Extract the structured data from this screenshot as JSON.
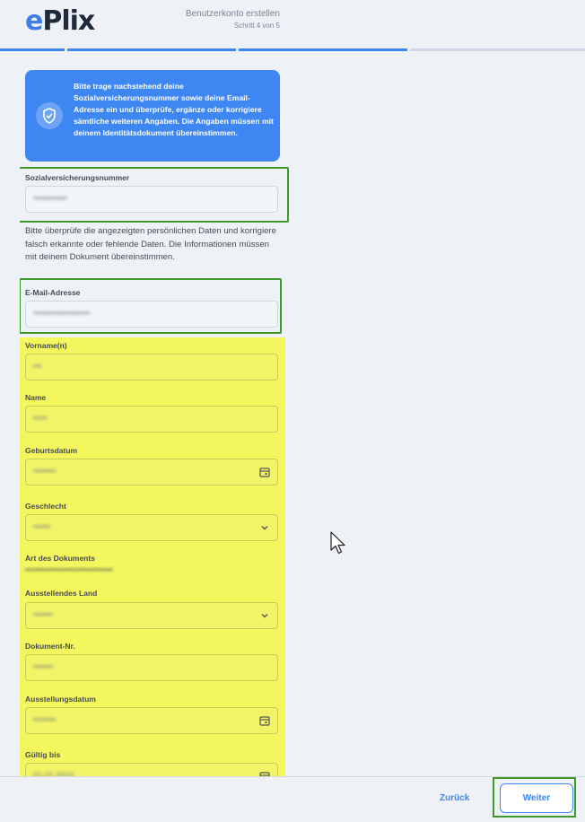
{
  "header": {
    "logo_e": "e",
    "logo_rest": "Plix",
    "title": "Benutzerkonto erstellen",
    "step": "Schritt 4 von 5"
  },
  "banner": {
    "icon": "shield-check-icon",
    "text": "Bitte trage nachstehend deine Sozialversicherungsnummer sowie deine Email-Adresse ein und überprüfe, ergänze oder korrigiere sämtliche weiteren Angaben. Die Angaben müssen mit deinem Identitätsdokument übereinstimmen."
  },
  "fields": {
    "svn": {
      "label": "Sozialversicherungsnummer",
      "value": "••••••••••••"
    },
    "info_text": "Bitte überprüfe die angezeigten persönlichen Daten und korrigiere falsch erkannte oder fehlende Daten. Die Informationen müssen mit deinem Dokument übereinstimmen.",
    "email": {
      "label": "E-Mail-Adresse",
      "value": "••••••••••••••••••••"
    },
    "vorname": {
      "label": "Vorname(n)",
      "value": "•••"
    },
    "name": {
      "label": "Name",
      "value": "•••••"
    },
    "geburtsdatum": {
      "label": "Geburtsdatum",
      "value": "••••••••"
    },
    "geschlecht": {
      "label": "Geschlecht",
      "value": "••••••"
    },
    "art_dokument": {
      "label": "Art des Dokuments",
      "value": "•••••••••••••••••••••••••••••••"
    },
    "land": {
      "label": "Ausstellendes Land",
      "value": "•••••••"
    },
    "dokument_nr": {
      "label": "Dokument-Nr.",
      "value": "•••••••"
    },
    "ausstellungsdatum": {
      "label": "Ausstellungsdatum",
      "value": "••••••••"
    },
    "gueltig_bis": {
      "label": "Gültig bis",
      "value": "01.01.2010"
    }
  },
  "footer": {
    "back_label": "Zurück",
    "next_label": "Weiter"
  },
  "colors": {
    "accent": "#3e86f2",
    "highlight_green": "#3c9a2a",
    "highlight_yellow": "#f4f63c"
  }
}
